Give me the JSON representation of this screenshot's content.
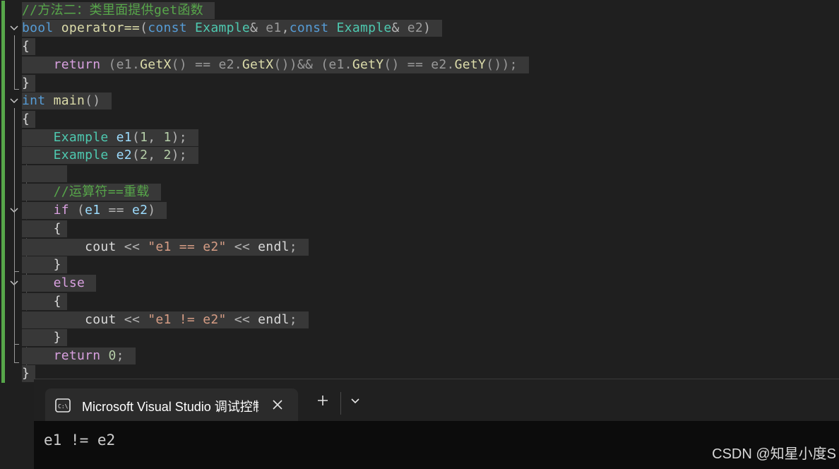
{
  "editor": {
    "lines": {
      "l1": {
        "comment": "//方法二：类里面提供get函数"
      },
      "l2": {
        "kw_bool": "bool",
        "fn_op": "operator==",
        "p1": "(",
        "kw_const1": "const",
        "t1": "Example",
        "amp1": "&",
        "e1": "e1",
        "comma": ",",
        "kw_const2": "const",
        "t2": "Example",
        "amp2": "&",
        "e2": "e2",
        "p2": ")"
      },
      "l3": {
        "brace": "{"
      },
      "l4": {
        "kw_return": "return",
        "a": "(e1.",
        "getx1": "GetX",
        "b": "() == e2.",
        "getx2": "GetX",
        "c": "())&& (e1.",
        "gety1": "GetY",
        "d": "() == e2.",
        "gety2": "GetY",
        "e": "());"
      },
      "l5": {
        "brace": "}"
      },
      "l6": {
        "kw_int": "int",
        "fn_main": "main",
        "paren": "()"
      },
      "l7": {
        "brace": "{"
      },
      "l8": {
        "type": "Example",
        "var": "e1",
        "args_open": "(",
        "n1": "1",
        "sep": ", ",
        "n2": "1",
        "args_close": ");"
      },
      "l9": {
        "type": "Example",
        "var": "e2",
        "args_open": "(",
        "n1": "2",
        "sep": ", ",
        "n2": "2",
        "args_close": ");"
      },
      "l11": {
        "comment": "//运算符==重载"
      },
      "l12": {
        "kw_if": "if",
        "open": "(",
        "v1": "e1",
        "op": " == ",
        "v2": "e2",
        "close": ")"
      },
      "l13": {
        "brace": "{"
      },
      "l14": {
        "cout": "cout",
        "op1": " << ",
        "str": "\"e1 == e2\"",
        "op2": " << ",
        "endl": "endl",
        "semi": ";"
      },
      "l15": {
        "brace": "}"
      },
      "l16": {
        "kw_else": "else"
      },
      "l17": {
        "brace": "{"
      },
      "l18": {
        "cout": "cout",
        "op1": " << ",
        "str": "\"e1 != e2\"",
        "op2": " << ",
        "endl": "endl",
        "semi": ";"
      },
      "l19": {
        "brace": "}"
      },
      "l20": {
        "kw_return": "return",
        "num": "0",
        "semi": ";"
      },
      "l21": {
        "brace": "}"
      }
    }
  },
  "terminal": {
    "tab_title": "Microsoft Visual Studio 调试控制台",
    "tab_icon": "console-icon",
    "close_icon": "close-icon",
    "new_tab_icon": "plus-icon",
    "dropdown_icon": "chevron-down-icon",
    "output": "e1 != e2"
  },
  "watermark": "CSDN @知星小度S",
  "colors": {
    "comment": "#57a64a",
    "keyword": "#569cd6",
    "control": "#d8a0df",
    "type": "#4ec9b0",
    "function": "#dcdcaa",
    "variable": "#9cdcfe",
    "string": "#d69d85",
    "number": "#b5cea8",
    "line_highlight": "#383838",
    "change_bar": "#57a64a"
  }
}
